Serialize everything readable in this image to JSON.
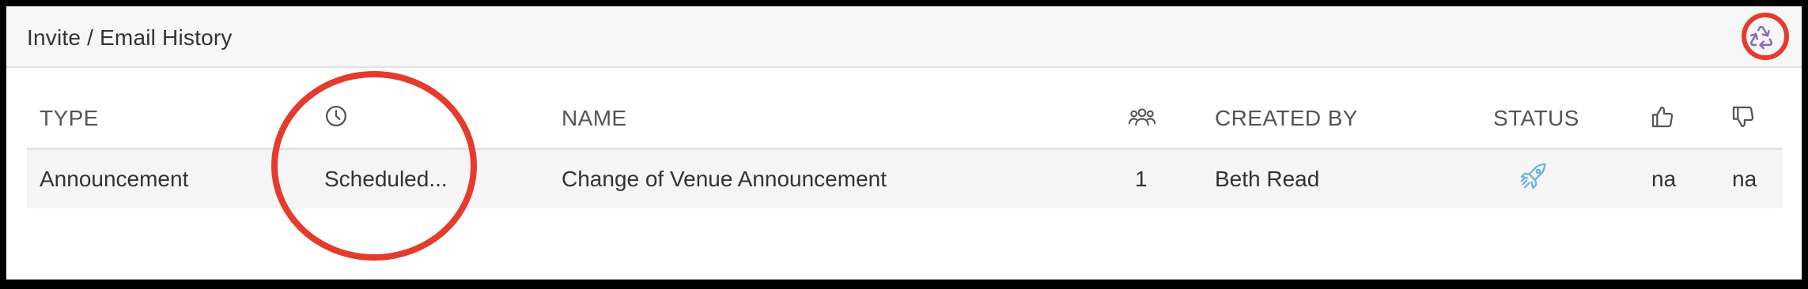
{
  "header": {
    "title": "Invite / Email History",
    "refresh_icon": "recycle-refresh-icon",
    "accent": "#8a6bb8"
  },
  "table": {
    "columns": {
      "type": "TYPE",
      "scheduled_icon": "clock-icon",
      "name": "NAME",
      "recipients_icon": "people-icon",
      "created_by": "CREATED BY",
      "status": "STATUS",
      "likes_icon": "thumbs-up-icon",
      "dislikes_icon": "thumbs-down-icon"
    },
    "rows": [
      {
        "type": "Announcement",
        "scheduled": "Scheduled...",
        "name": "Change of Venue Announcement",
        "recipients": "1",
        "created_by": "Beth Read",
        "status_icon": "rocket-icon",
        "likes": "na",
        "dislikes": "na"
      }
    ]
  },
  "annotations": {
    "highlight_color": "#e53b2c",
    "status_icon_color": "#6fb6d8"
  }
}
